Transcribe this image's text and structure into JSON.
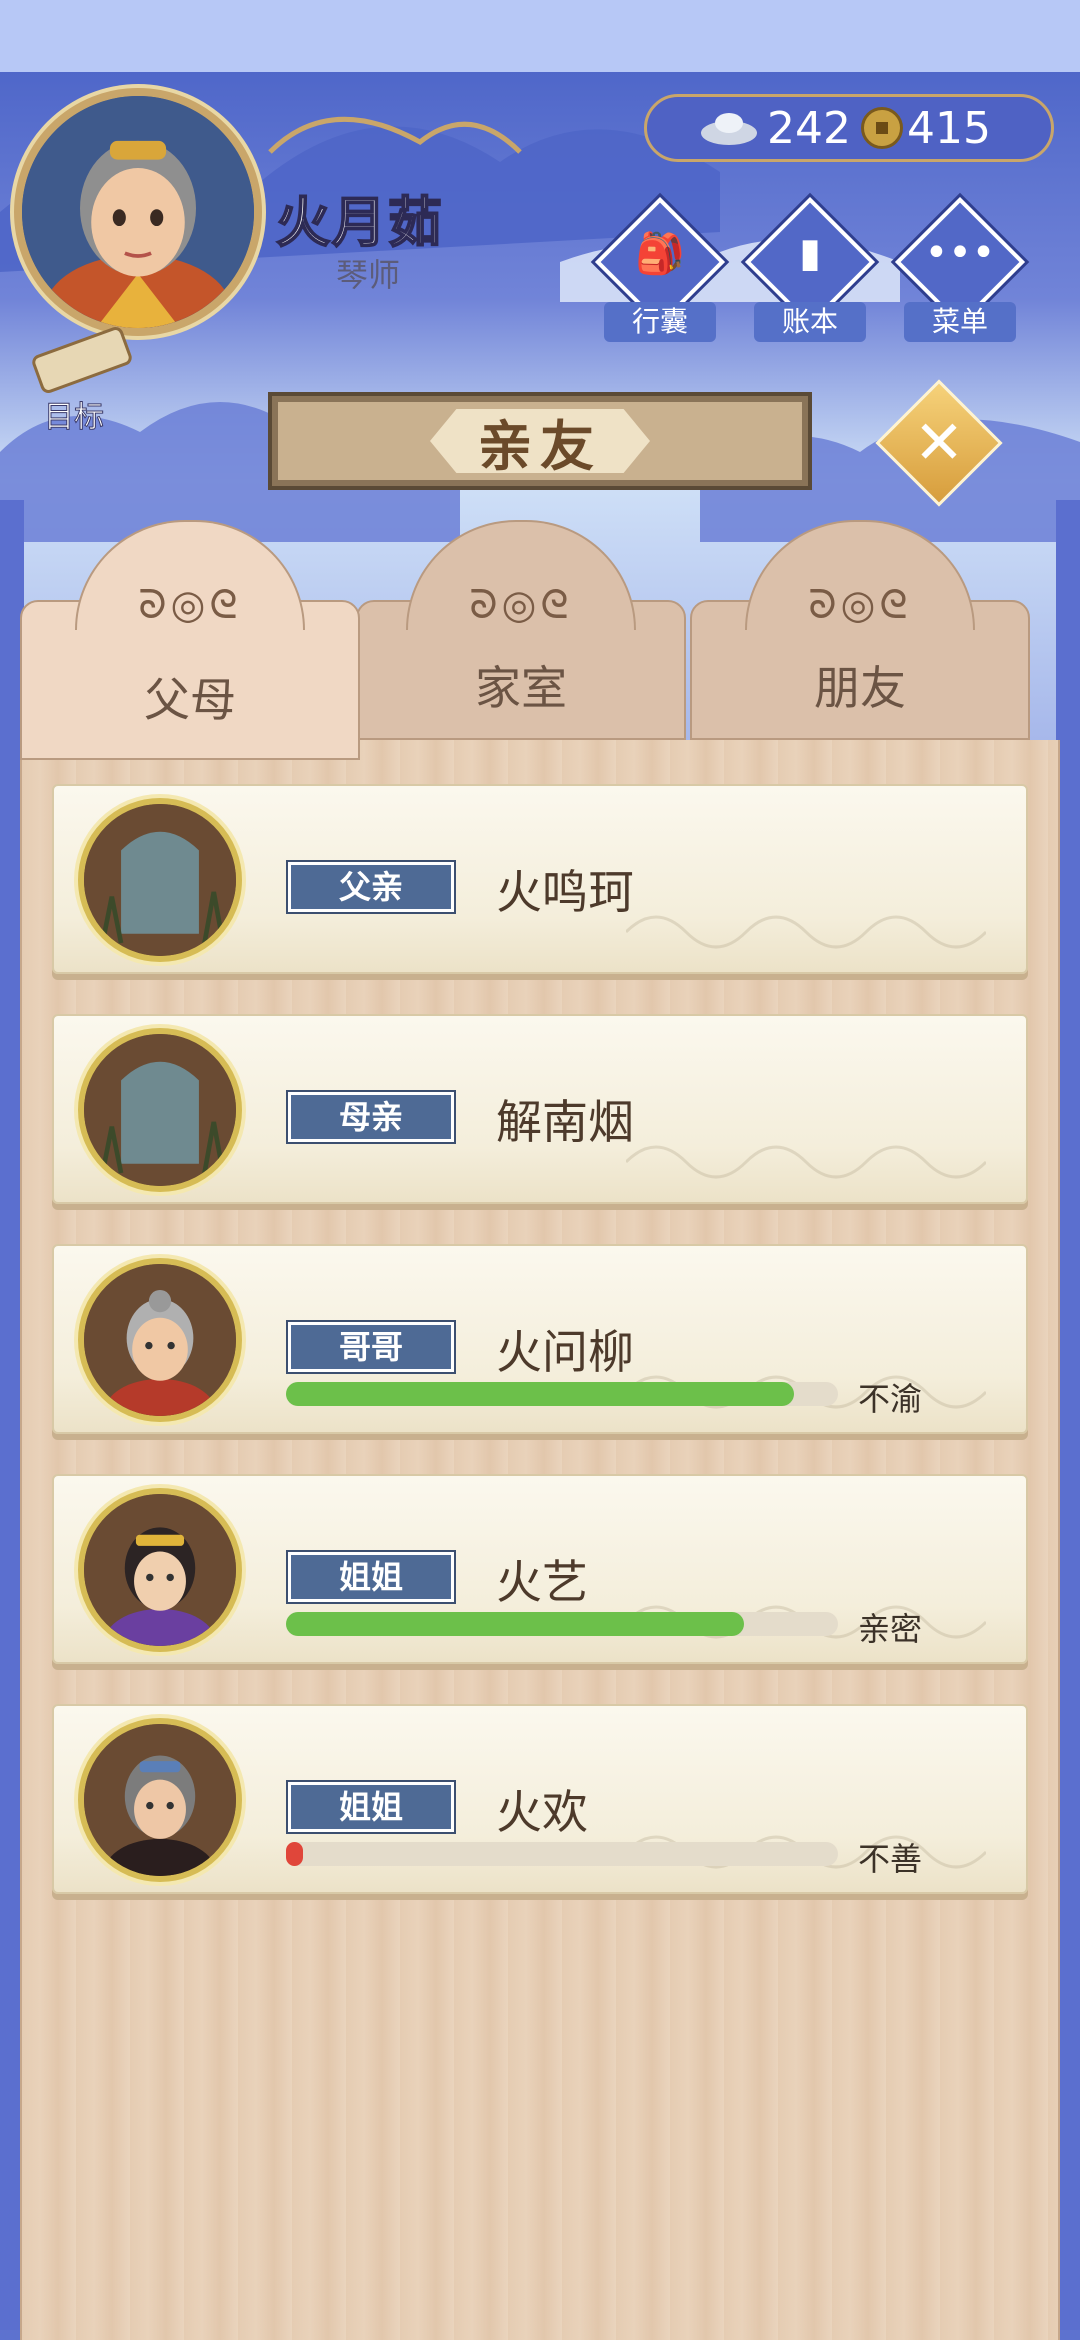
{
  "header": {
    "player_name": "火月茹",
    "player_title": "琴师",
    "silver_amount": "242",
    "coin_amount": "415",
    "buttons": [
      {
        "label": "行囊",
        "icon": "bag-icon"
      },
      {
        "label": "账本",
        "icon": "ledger-icon"
      },
      {
        "label": "菜单",
        "icon": "menu-dots-icon"
      }
    ],
    "goal_label": "目标"
  },
  "title": "亲友",
  "tabs": [
    {
      "label": "父母",
      "active": true
    },
    {
      "label": "家室",
      "active": false
    },
    {
      "label": "朋友",
      "active": false
    }
  ],
  "relatives": [
    {
      "relation": "父亲",
      "name": "火鸣珂",
      "deceased": true
    },
    {
      "relation": "母亲",
      "name": "解南烟",
      "deceased": true
    },
    {
      "relation": "哥哥",
      "name": "火问柳",
      "deceased": false,
      "affinity": 0.92,
      "bar_color": "#6cc04a",
      "status": "不渝"
    },
    {
      "relation": "姐姐",
      "name": "火艺",
      "deceased": false,
      "affinity": 0.83,
      "bar_color": "#6cc04a",
      "status": "亲密"
    },
    {
      "relation": "姐姐",
      "name": "火欢",
      "deceased": false,
      "affinity": 0.02,
      "bar_color": "#e0463a",
      "status": "不善"
    }
  ]
}
